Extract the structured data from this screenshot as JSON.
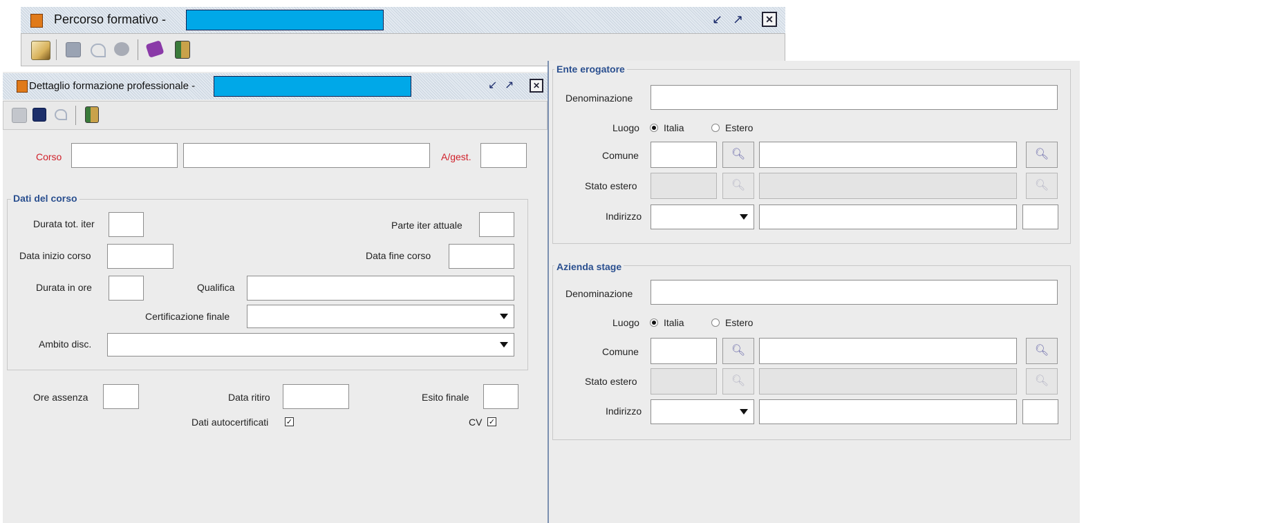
{
  "outer_window": {
    "title": "Percorso formativo -"
  },
  "detail_window": {
    "title": "Dettaglio formazione professionale -",
    "corso_label": "Corso",
    "agest_label": "A/gest.",
    "dati_corso": {
      "group_title": "Dati del corso",
      "durata_tot_iter_label": "Durata tot. iter",
      "parte_iter_label": "Parte iter attuale",
      "data_inizio_label": "Data inizio corso",
      "data_fine_label": "Data fine corso",
      "durata_ore_label": "Durata in ore",
      "qualifica_label": "Qualifica",
      "certificazione_label": "Certificazione finale",
      "ambito_label": "Ambito disc."
    },
    "ore_assenza_label": "Ore assenza",
    "data_ritiro_label": "Data ritiro",
    "esito_finale_label": "Esito finale",
    "dati_autocert_label": "Dati autocertificati",
    "dati_autocert_checked": true,
    "cv_label": "CV",
    "cv_checked": true
  },
  "ente_erogatore": {
    "group_title": "Ente erogatore",
    "denominazione_label": "Denominazione",
    "luogo_label": "Luogo",
    "italia_label": "Italia",
    "estero_label": "Estero",
    "luogo_selected": "Italia",
    "comune_label": "Comune",
    "stato_estero_label": "Stato estero",
    "indirizzo_label": "Indirizzo"
  },
  "azienda_stage": {
    "group_title": "Azienda stage",
    "denominazione_label": "Denominazione",
    "luogo_label": "Luogo",
    "italia_label": "Italia",
    "estero_label": "Estero",
    "luogo_selected": "Italia",
    "comune_label": "Comune",
    "stato_estero_label": "Stato estero",
    "indirizzo_label": "Indirizzo"
  },
  "colors": {
    "required_label": "#d0202a",
    "group_title": "#2a4f8f",
    "redaction": "#00a8e8"
  },
  "icons": {
    "binoculars": "⛖"
  }
}
